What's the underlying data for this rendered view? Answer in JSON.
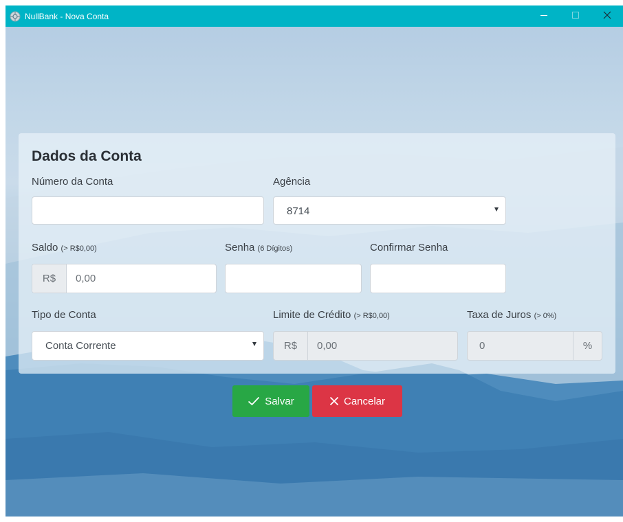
{
  "window": {
    "title": "NullBank - Nova Conta",
    "accent_color": "#00b4c6",
    "app_icon": "nullbank-logo-icon",
    "controls": [
      "minimize-icon",
      "maximize-icon",
      "close-icon"
    ]
  },
  "form": {
    "heading": "Dados da Conta",
    "numero_conta": {
      "label": "Número da Conta",
      "value": ""
    },
    "agencia": {
      "label": "Agência",
      "value": "8714"
    },
    "saldo": {
      "label": "Saldo",
      "hint": "(> R$0,00)",
      "prefix": "R$",
      "placeholder": "0,00",
      "value": ""
    },
    "senha": {
      "label": "Senha",
      "hint": "(6 Dígitos)",
      "value": ""
    },
    "confirmar_senha": {
      "label": "Confirmar Senha",
      "value": ""
    },
    "tipo_conta": {
      "label": "Tipo de Conta",
      "value": "Conta Corrente"
    },
    "limite_credito": {
      "label": "Limite de Crédito",
      "hint": "(> R$0,00)",
      "prefix": "R$",
      "placeholder": "0,00",
      "disabled": true
    },
    "taxa_juros": {
      "label": "Taxa de Juros",
      "hint": "(> 0%)",
      "placeholder": "0",
      "suffix": "%",
      "disabled": true
    }
  },
  "buttons": {
    "save": {
      "label": "Salvar",
      "icon": "check-icon",
      "color": "#28a745"
    },
    "cancel": {
      "label": "Cancelar",
      "icon": "close-icon",
      "color": "#dc3545"
    }
  }
}
